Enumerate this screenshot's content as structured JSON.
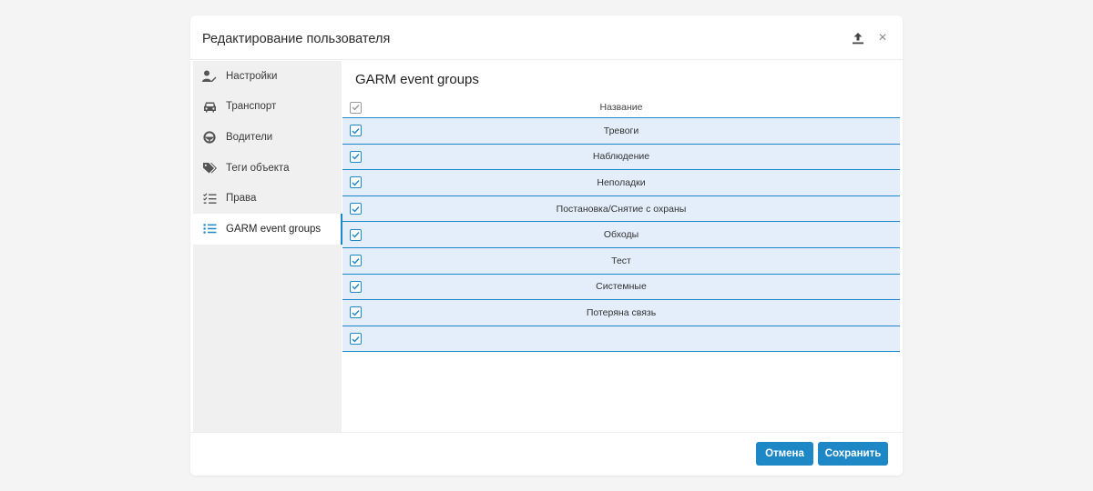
{
  "dialog": {
    "title": "Редактирование пользователя",
    "icons": {
      "upload": "upload-icon",
      "close": "close-icon"
    },
    "close_glyph": "×"
  },
  "sidebar": {
    "items": [
      {
        "label": "Настройки",
        "icon": "user-settings-icon",
        "active": false
      },
      {
        "label": "Транспорт",
        "icon": "car-icon",
        "active": false
      },
      {
        "label": "Водители",
        "icon": "steering-wheel-icon",
        "active": false
      },
      {
        "label": "Теги объекта",
        "icon": "tags-icon",
        "active": false
      },
      {
        "label": "Права",
        "icon": "checklist-icon",
        "active": false
      },
      {
        "label": "GARM event groups",
        "icon": "list-icon",
        "active": true
      }
    ]
  },
  "main": {
    "title": "GARM event groups",
    "table": {
      "header": "Название",
      "rows": [
        {
          "name": "Тревоги",
          "checked": true
        },
        {
          "name": "Наблюдение",
          "checked": true
        },
        {
          "name": "Неполадки",
          "checked": true
        },
        {
          "name": "Постановка/Снятие с охраны",
          "checked": true
        },
        {
          "name": "Обходы",
          "checked": true
        },
        {
          "name": "Тест",
          "checked": true
        },
        {
          "name": "Системные",
          "checked": true
        },
        {
          "name": "Потеряна связь",
          "checked": true
        },
        {
          "name": "",
          "checked": true
        }
      ]
    }
  },
  "footer": {
    "cancel_label": "Отмена",
    "save_label": "Сохранить"
  },
  "colors": {
    "accent": "#1e88c7",
    "row_bg": "#e3eefa",
    "sidebar_bg": "#f0f0f0",
    "page_bg": "#f4f4f5"
  }
}
